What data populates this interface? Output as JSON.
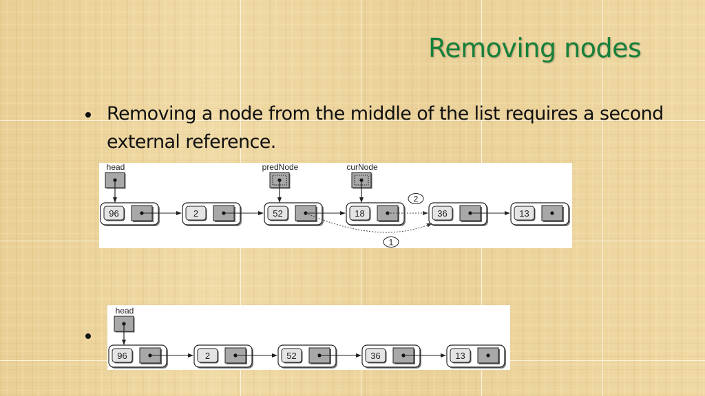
{
  "slide": {
    "title": "Removing nodes",
    "bullets": [
      {
        "text": "Removing a node from the middle of the list requires a second external reference."
      },
      {
        "text": ""
      }
    ]
  },
  "diagram_before": {
    "references": [
      {
        "label": "head",
        "points_to_index": 0,
        "style": "solid"
      },
      {
        "label": "predNode",
        "points_to_index": 2,
        "style": "dotted"
      },
      {
        "label": "curNode",
        "points_to_index": 3,
        "style": "dotted"
      }
    ],
    "nodes": [
      "96",
      "2",
      "52",
      "18",
      "36",
      "13"
    ],
    "steps": [
      {
        "number": "1",
        "description": "predNode.next relinked (dashed) to node 36"
      },
      {
        "number": "2",
        "description": "curNode link to node 36 removed (dotted)"
      }
    ]
  },
  "diagram_after": {
    "references": [
      {
        "label": "head",
        "points_to_index": 0,
        "style": "solid"
      }
    ],
    "nodes": [
      "96",
      "2",
      "52",
      "36",
      "13"
    ]
  },
  "colors": {
    "title": "#17803a",
    "text": "#111111",
    "node_value_fill": "#e4e4e4",
    "node_link_fill": "#a8a8a8",
    "background": "#ecd49c"
  }
}
